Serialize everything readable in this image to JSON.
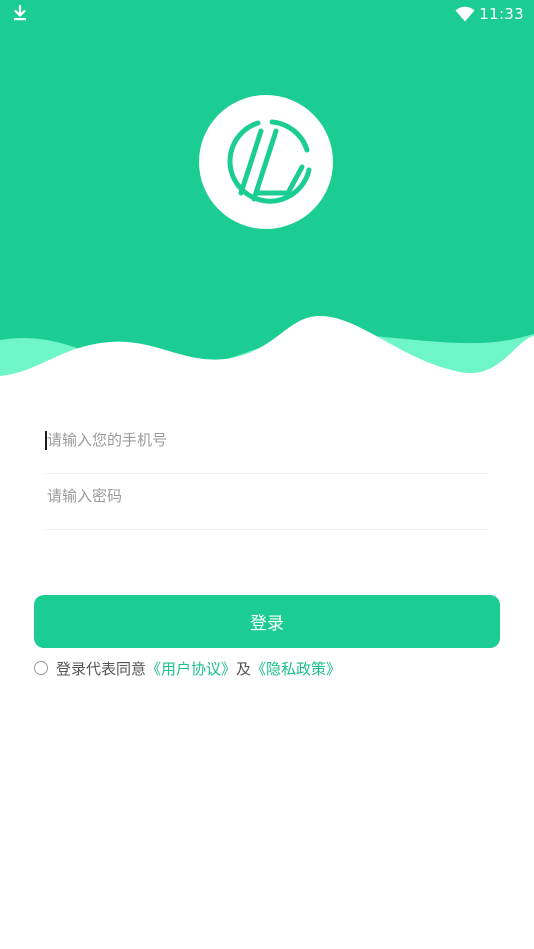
{
  "colors": {
    "primary": "#1ccd93",
    "wave_light": "#6ef5c8",
    "link": "#1bbf88"
  },
  "status_bar": {
    "time": "11:33",
    "icons": [
      "download-icon",
      "wifi-icon"
    ]
  },
  "logo": {
    "icon": "app-logo"
  },
  "form": {
    "phone_placeholder": "请输入您的手机号",
    "password_placeholder": "请输入密码"
  },
  "login_button": {
    "label": "登录"
  },
  "agreement": {
    "prefix": "登录代表同意",
    "user_agreement": "《用户协议》",
    "conjunction": "及",
    "privacy_policy": "《隐私政策》"
  }
}
